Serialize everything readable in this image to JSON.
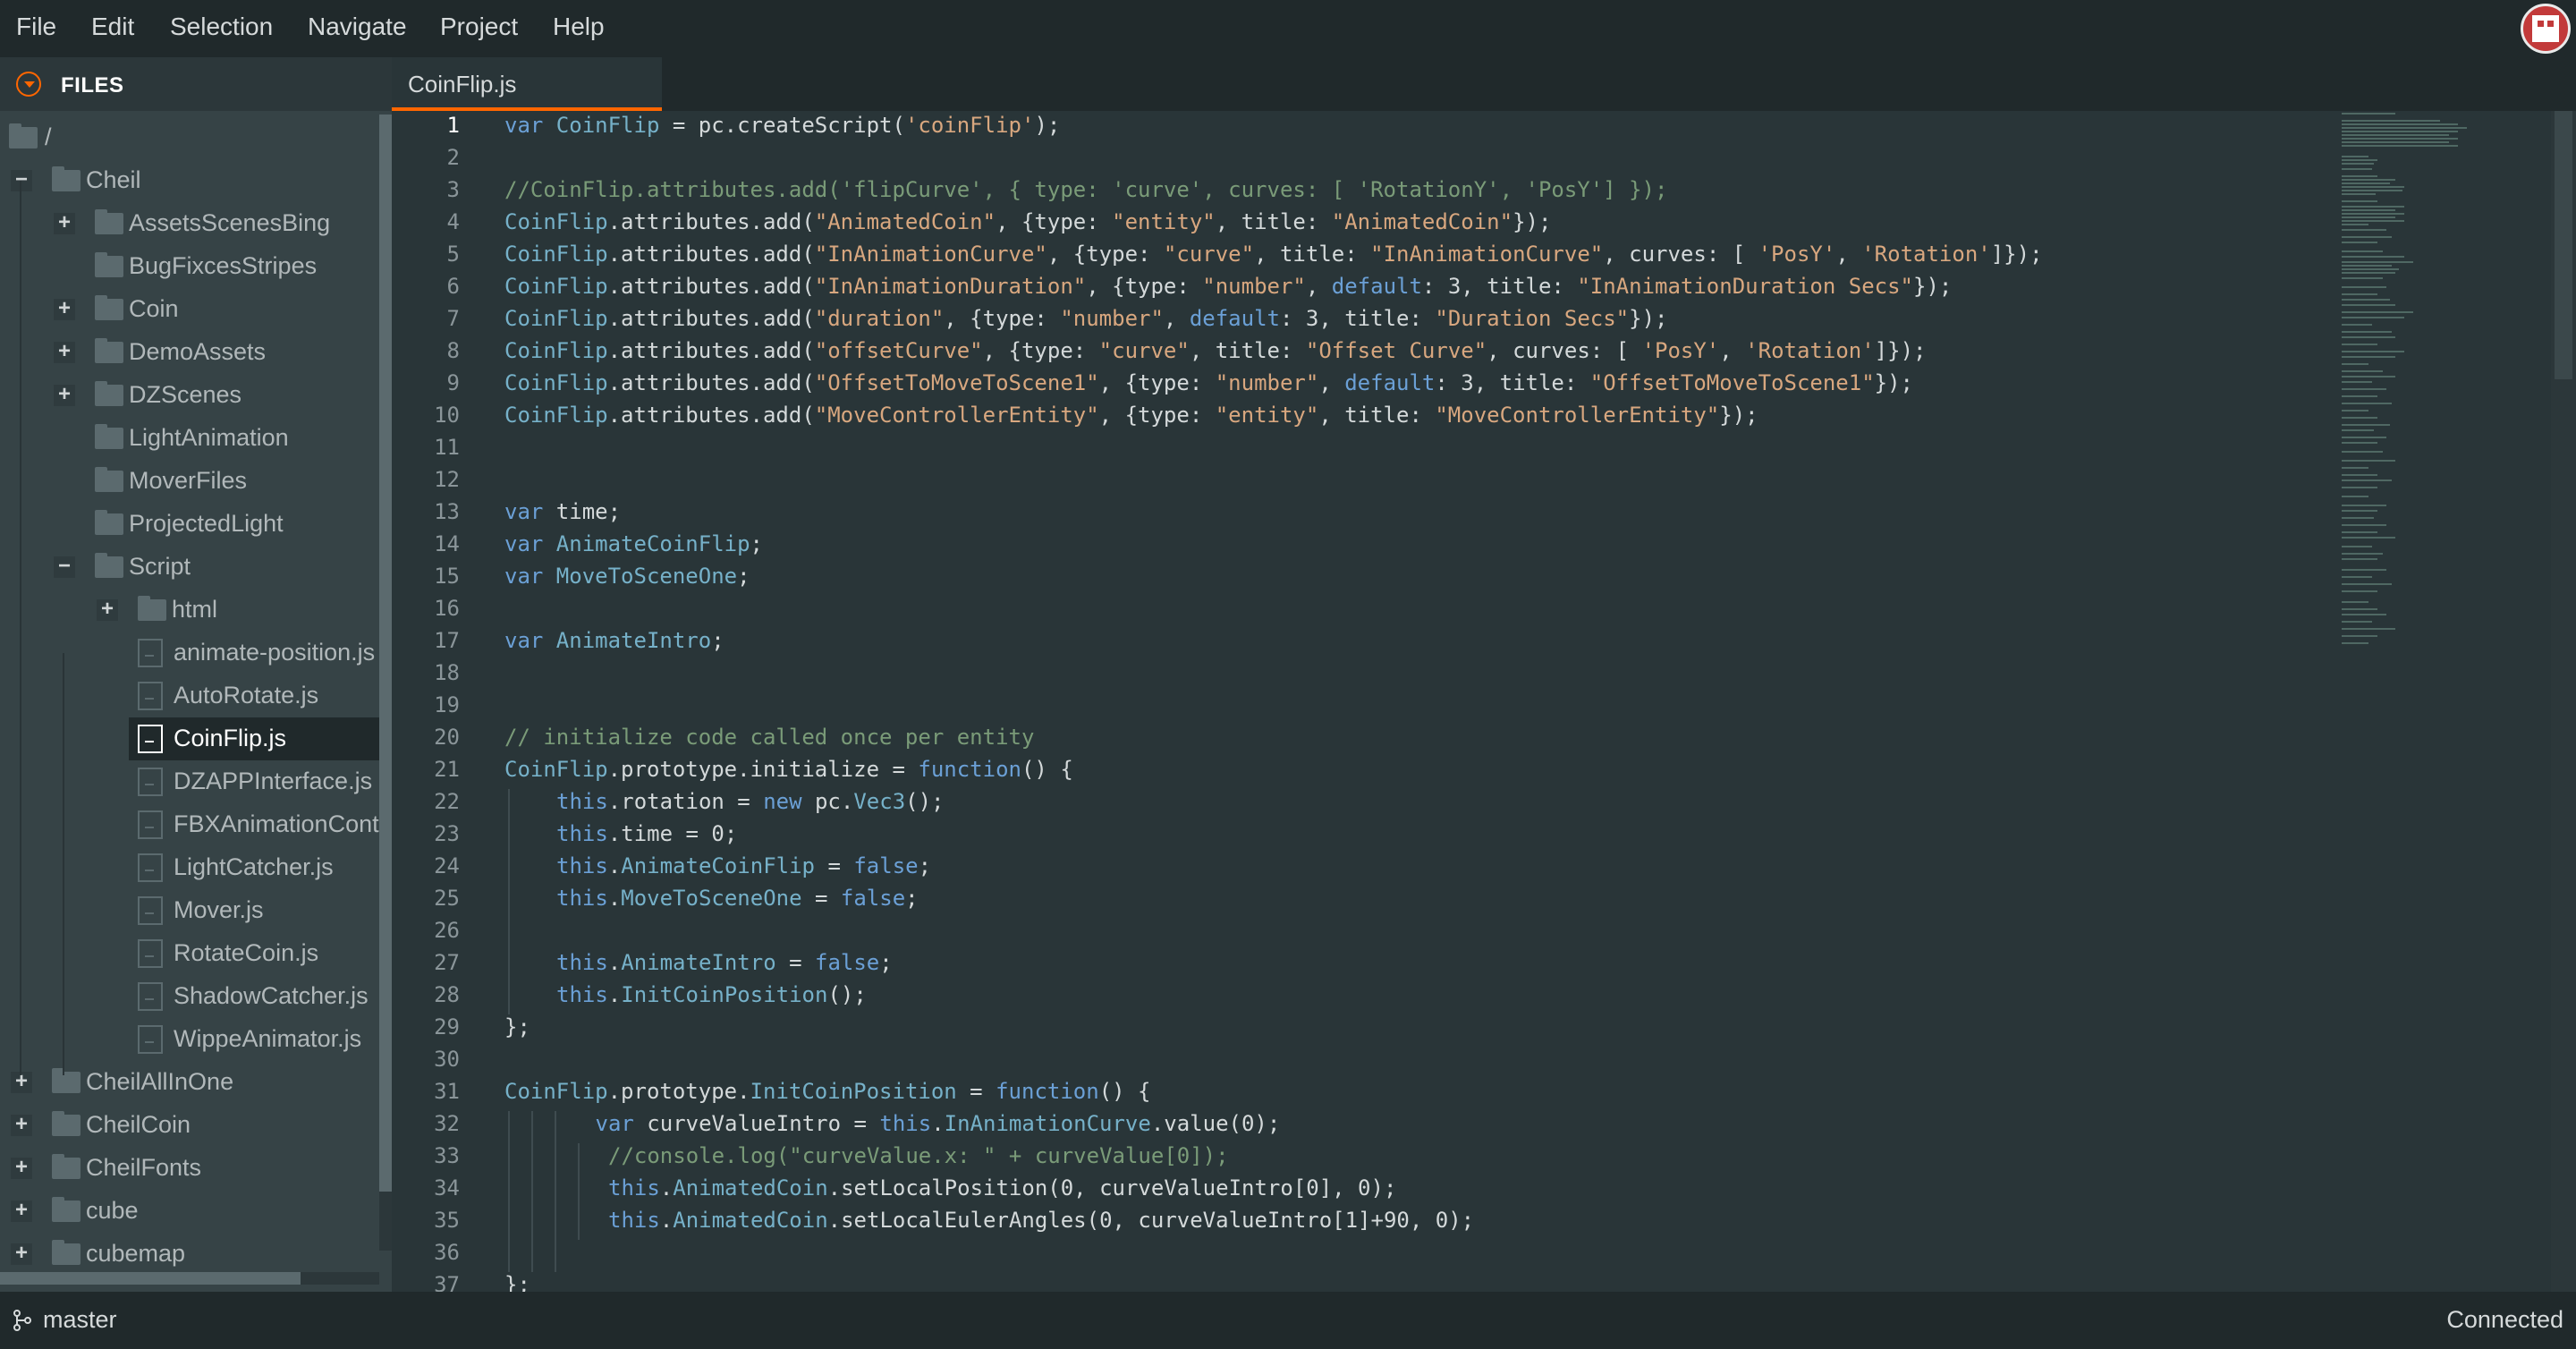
{
  "menu": [
    "File",
    "Edit",
    "Selection",
    "Navigate",
    "Project",
    "Help"
  ],
  "colors": {
    "accent": "#ff6600",
    "keyword": "#6ba0d6",
    "identifier": "#76b1c9",
    "string": "#d8a77f",
    "comment": "#7a9b78",
    "number": "#d4d9da",
    "plain": "#d4d9da"
  },
  "files_panel": {
    "title": "FILES",
    "tree": [
      {
        "label": "/",
        "type": "folder",
        "depth": 0,
        "toggle": ""
      },
      {
        "label": "Cheil",
        "type": "folder",
        "depth": 0,
        "toggle": "−"
      },
      {
        "label": "AssetsScenesBing",
        "type": "folder",
        "depth": 1,
        "toggle": "+"
      },
      {
        "label": "BugFixcesStripes",
        "type": "folder",
        "depth": 1,
        "toggle": ""
      },
      {
        "label": "Coin",
        "type": "folder",
        "depth": 1,
        "toggle": "+"
      },
      {
        "label": "DemoAssets",
        "type": "folder",
        "depth": 1,
        "toggle": "+"
      },
      {
        "label": "DZScenes",
        "type": "folder",
        "depth": 1,
        "toggle": "+"
      },
      {
        "label": "LightAnimation",
        "type": "folder",
        "depth": 1,
        "toggle": ""
      },
      {
        "label": "MoverFiles",
        "type": "folder",
        "depth": 1,
        "toggle": ""
      },
      {
        "label": "ProjectedLight",
        "type": "folder",
        "depth": 1,
        "toggle": ""
      },
      {
        "label": "Script",
        "type": "folder",
        "depth": 1,
        "toggle": "−"
      },
      {
        "label": "html",
        "type": "folder",
        "depth": 2,
        "toggle": "+"
      },
      {
        "label": "animate-position.js",
        "type": "file",
        "depth": 2,
        "toggle": ""
      },
      {
        "label": "AutoRotate.js",
        "type": "file",
        "depth": 2,
        "toggle": ""
      },
      {
        "label": "CoinFlip.js",
        "type": "file",
        "depth": 2,
        "toggle": "",
        "selected": true
      },
      {
        "label": "DZAPPInterface.js",
        "type": "file",
        "depth": 2,
        "toggle": ""
      },
      {
        "label": "FBXAnimationCont",
        "type": "file",
        "depth": 2,
        "toggle": ""
      },
      {
        "label": "LightCatcher.js",
        "type": "file",
        "depth": 2,
        "toggle": ""
      },
      {
        "label": "Mover.js",
        "type": "file",
        "depth": 2,
        "toggle": ""
      },
      {
        "label": "RotateCoin.js",
        "type": "file",
        "depth": 2,
        "toggle": ""
      },
      {
        "label": "ShadowCatcher.js",
        "type": "file",
        "depth": 2,
        "toggle": ""
      },
      {
        "label": "WippeAnimator.js",
        "type": "file",
        "depth": 2,
        "toggle": ""
      },
      {
        "label": "CheilAllInOne",
        "type": "folder",
        "depth": 0,
        "toggle": "+"
      },
      {
        "label": "CheilCoin",
        "type": "folder",
        "depth": 0,
        "toggle": "+"
      },
      {
        "label": "CheilFonts",
        "type": "folder",
        "depth": 0,
        "toggle": "+"
      },
      {
        "label": "cube",
        "type": "folder",
        "depth": 0,
        "toggle": "+"
      },
      {
        "label": "cubemap",
        "type": "folder",
        "depth": 0,
        "toggle": "+"
      }
    ]
  },
  "editor": {
    "tab": "CoinFlip.js",
    "current_line": 1,
    "lines": [
      {
        "n": "1",
        "indent": 0,
        "tokens": [
          [
            "k",
            "var "
          ],
          [
            "i",
            "CoinFlip"
          ],
          [
            "p",
            " = pc.createScript("
          ],
          [
            "s",
            "'coinFlip'"
          ],
          [
            "p",
            ");"
          ]
        ]
      },
      {
        "n": "2",
        "indent": 0,
        "tokens": []
      },
      {
        "n": "3",
        "indent": 0,
        "tokens": [
          [
            "c",
            "//CoinFlip.attributes.add('flipCurve', { type: 'curve', curves: [ 'RotationY', 'PosY'] });"
          ]
        ]
      },
      {
        "n": "4",
        "indent": 0,
        "tokens": [
          [
            "i",
            "CoinFlip"
          ],
          [
            "p",
            ".attributes.add("
          ],
          [
            "s",
            "\"AnimatedCoin\""
          ],
          [
            "p",
            ", {type: "
          ],
          [
            "s",
            "\"entity\""
          ],
          [
            "p",
            ", title: "
          ],
          [
            "s",
            "\"AnimatedCoin\""
          ],
          [
            "p",
            "});"
          ]
        ]
      },
      {
        "n": "5",
        "indent": 0,
        "tokens": [
          [
            "i",
            "CoinFlip"
          ],
          [
            "p",
            ".attributes.add("
          ],
          [
            "s",
            "\"InAnimationCurve\""
          ],
          [
            "p",
            ", {type: "
          ],
          [
            "s",
            "\"curve\""
          ],
          [
            "p",
            ", title: "
          ],
          [
            "s",
            "\"InAnimationCurve\""
          ],
          [
            "p",
            ", curves: [ "
          ],
          [
            "s",
            "'PosY'"
          ],
          [
            "p",
            ", "
          ],
          [
            "s",
            "'Rotation'"
          ],
          [
            "p",
            "]});"
          ]
        ]
      },
      {
        "n": "6",
        "indent": 0,
        "tokens": [
          [
            "i",
            "CoinFlip"
          ],
          [
            "p",
            ".attributes.add("
          ],
          [
            "s",
            "\"InAnimationDuration\""
          ],
          [
            "p",
            ", {type: "
          ],
          [
            "s",
            "\"number\""
          ],
          [
            "p",
            ", "
          ],
          [
            "k",
            "default"
          ],
          [
            "p",
            ": 3, title: "
          ],
          [
            "s",
            "\"InAnimationDuration Secs\""
          ],
          [
            "p",
            "});"
          ]
        ]
      },
      {
        "n": "7",
        "indent": 0,
        "tokens": [
          [
            "i",
            "CoinFlip"
          ],
          [
            "p",
            ".attributes.add("
          ],
          [
            "s",
            "\"duration\""
          ],
          [
            "p",
            ", {type: "
          ],
          [
            "s",
            "\"number\""
          ],
          [
            "p",
            ", "
          ],
          [
            "k",
            "default"
          ],
          [
            "p",
            ": 3, title: "
          ],
          [
            "s",
            "\"Duration Secs\""
          ],
          [
            "p",
            "});"
          ]
        ]
      },
      {
        "n": "8",
        "indent": 0,
        "tokens": [
          [
            "i",
            "CoinFlip"
          ],
          [
            "p",
            ".attributes.add("
          ],
          [
            "s",
            "\"offsetCurve\""
          ],
          [
            "p",
            ", {type: "
          ],
          [
            "s",
            "\"curve\""
          ],
          [
            "p",
            ", title: "
          ],
          [
            "s",
            "\"Offset Curve\""
          ],
          [
            "p",
            ", curves: [ "
          ],
          [
            "s",
            "'PosY'"
          ],
          [
            "p",
            ", "
          ],
          [
            "s",
            "'Rotation'"
          ],
          [
            "p",
            "]});"
          ]
        ]
      },
      {
        "n": "9",
        "indent": 0,
        "tokens": [
          [
            "i",
            "CoinFlip"
          ],
          [
            "p",
            ".attributes.add("
          ],
          [
            "s",
            "\"OffsetToMoveToScene1\""
          ],
          [
            "p",
            ", {type: "
          ],
          [
            "s",
            "\"number\""
          ],
          [
            "p",
            ", "
          ],
          [
            "k",
            "default"
          ],
          [
            "p",
            ": 3, title: "
          ],
          [
            "s",
            "\"OffsetToMoveToScene1\""
          ],
          [
            "p",
            "});"
          ]
        ]
      },
      {
        "n": "10",
        "indent": 0,
        "tokens": [
          [
            "i",
            "CoinFlip"
          ],
          [
            "p",
            ".attributes.add("
          ],
          [
            "s",
            "\"MoveControllerEntity\""
          ],
          [
            "p",
            ", {type: "
          ],
          [
            "s",
            "\"entity\""
          ],
          [
            "p",
            ", title: "
          ],
          [
            "s",
            "\"MoveControllerEntity\""
          ],
          [
            "p",
            "});"
          ]
        ]
      },
      {
        "n": "11",
        "indent": 0,
        "tokens": []
      },
      {
        "n": "12",
        "indent": 0,
        "tokens": []
      },
      {
        "n": "13",
        "indent": 0,
        "tokens": [
          [
            "k",
            "var "
          ],
          [
            "p",
            "time;"
          ]
        ]
      },
      {
        "n": "14",
        "indent": 0,
        "tokens": [
          [
            "k",
            "var "
          ],
          [
            "i",
            "AnimateCoinFlip"
          ],
          [
            "p",
            ";"
          ]
        ]
      },
      {
        "n": "15",
        "indent": 0,
        "tokens": [
          [
            "k",
            "var "
          ],
          [
            "i",
            "MoveToSceneOne"
          ],
          [
            "p",
            ";"
          ]
        ]
      },
      {
        "n": "16",
        "indent": 0,
        "tokens": []
      },
      {
        "n": "17",
        "indent": 0,
        "tokens": [
          [
            "k",
            "var "
          ],
          [
            "i",
            "AnimateIntro"
          ],
          [
            "p",
            ";"
          ]
        ]
      },
      {
        "n": "18",
        "indent": 0,
        "tokens": []
      },
      {
        "n": "19",
        "indent": 0,
        "tokens": []
      },
      {
        "n": "20",
        "indent": 0,
        "tokens": [
          [
            "c",
            "// initialize code called once per entity"
          ]
        ]
      },
      {
        "n": "21",
        "indent": 0,
        "tokens": [
          [
            "i",
            "CoinFlip"
          ],
          [
            "p",
            ".prototype.initialize = "
          ],
          [
            "k",
            "function"
          ],
          [
            "p",
            "() {"
          ]
        ]
      },
      {
        "n": "22",
        "indent": 1,
        "tokens": [
          [
            "k",
            "this"
          ],
          [
            "p",
            ".rotation = "
          ],
          [
            "k",
            "new "
          ],
          [
            "p",
            "pc."
          ],
          [
            "i",
            "Vec3"
          ],
          [
            "p",
            "();"
          ]
        ]
      },
      {
        "n": "23",
        "indent": 1,
        "tokens": [
          [
            "k",
            "this"
          ],
          [
            "p",
            ".time = 0;"
          ]
        ]
      },
      {
        "n": "24",
        "indent": 1,
        "tokens": [
          [
            "k",
            "this"
          ],
          [
            "p",
            "."
          ],
          [
            "i",
            "AnimateCoinFlip"
          ],
          [
            "p",
            " = "
          ],
          [
            "k",
            "false"
          ],
          [
            "p",
            ";"
          ]
        ]
      },
      {
        "n": "25",
        "indent": 1,
        "tokens": [
          [
            "k",
            "this"
          ],
          [
            "p",
            "."
          ],
          [
            "i",
            "MoveToSceneOne"
          ],
          [
            "p",
            " = "
          ],
          [
            "k",
            "false"
          ],
          [
            "p",
            ";"
          ]
        ]
      },
      {
        "n": "26",
        "indent": 1,
        "tokens": []
      },
      {
        "n": "27",
        "indent": 1,
        "tokens": [
          [
            "k",
            "this"
          ],
          [
            "p",
            "."
          ],
          [
            "i",
            "AnimateIntro"
          ],
          [
            "p",
            " = "
          ],
          [
            "k",
            "false"
          ],
          [
            "p",
            ";"
          ]
        ]
      },
      {
        "n": "28",
        "indent": 1,
        "tokens": [
          [
            "k",
            "this"
          ],
          [
            "p",
            "."
          ],
          [
            "i",
            "InitCoinPosition"
          ],
          [
            "p",
            "();"
          ]
        ]
      },
      {
        "n": "29",
        "indent": 0,
        "tokens": [
          [
            "p",
            "};"
          ]
        ]
      },
      {
        "n": "30",
        "indent": 0,
        "tokens": []
      },
      {
        "n": "31",
        "indent": 0,
        "tokens": [
          [
            "i",
            "CoinFlip"
          ],
          [
            "p",
            ".prototype."
          ],
          [
            "i",
            "InitCoinPosition"
          ],
          [
            "p",
            " = "
          ],
          [
            "k",
            "function"
          ],
          [
            "p",
            "() {"
          ]
        ]
      },
      {
        "n": "32",
        "indent": 1.75,
        "tokens": [
          [
            "k",
            "var "
          ],
          [
            "p",
            "curveValueIntro = "
          ],
          [
            "k",
            "this"
          ],
          [
            "p",
            "."
          ],
          [
            "i",
            "InAnimationCurve"
          ],
          [
            "p",
            ".value(0);"
          ]
        ]
      },
      {
        "n": "33",
        "indent": 2,
        "tokens": [
          [
            "c",
            "//console.log(\"curveValue.x: \" + curveValue[0]);"
          ]
        ]
      },
      {
        "n": "34",
        "indent": 2,
        "tokens": [
          [
            "k",
            "this"
          ],
          [
            "p",
            "."
          ],
          [
            "i",
            "AnimatedCoin"
          ],
          [
            "p",
            ".setLocalPosition(0, curveValueIntro[0], 0);"
          ]
        ]
      },
      {
        "n": "35",
        "indent": 2,
        "tokens": [
          [
            "k",
            "this"
          ],
          [
            "p",
            "."
          ],
          [
            "i",
            "AnimatedCoin"
          ],
          [
            "p",
            ".setLocalEulerAngles(0, curveValueIntro[1]+90, 0);"
          ]
        ]
      },
      {
        "n": "36",
        "indent": 0,
        "tokens": []
      },
      {
        "n": "37",
        "indent": 0,
        "tokens": [
          [
            "p",
            "};"
          ]
        ]
      }
    ]
  },
  "status": {
    "branch": "master",
    "connection": "Connected"
  }
}
